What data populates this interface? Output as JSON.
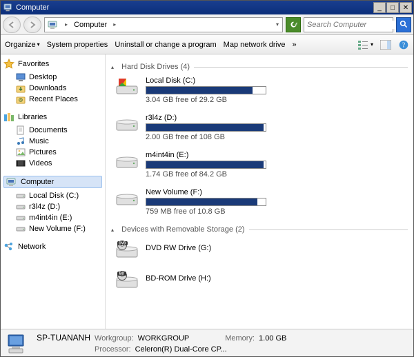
{
  "window": {
    "title": "Computer"
  },
  "address": {
    "location": "Computer"
  },
  "search": {
    "placeholder": "Search Computer"
  },
  "toolbar": {
    "organize": "Organize",
    "sysprops": "System properties",
    "uninstall": "Uninstall or change a program",
    "mapdrive": "Map network drive",
    "overflow": "»"
  },
  "sidebar": {
    "favorites": {
      "label": "Favorites",
      "items": [
        "Desktop",
        "Downloads",
        "Recent Places"
      ]
    },
    "libraries": {
      "label": "Libraries",
      "items": [
        "Documents",
        "Music",
        "Pictures",
        "Videos"
      ]
    },
    "computer": {
      "label": "Computer",
      "items": [
        "Local Disk (C:)",
        "r3l4z (D:)",
        "m4int4in (E:)",
        "New Volume (F:)"
      ]
    },
    "network": {
      "label": "Network"
    }
  },
  "sections": {
    "hdd": {
      "title": "Hard Disk Drives (4)"
    },
    "rem": {
      "title": "Devices with Removable Storage (2)"
    }
  },
  "drives": {
    "hdd": [
      {
        "name": "Local Disk (C:)",
        "free": "3.04 GB free of 29.2 GB",
        "pct": 89
      },
      {
        "name": "r3l4z (D:)",
        "free": "2.00 GB free of 108 GB",
        "pct": 98
      },
      {
        "name": "m4int4in (E:)",
        "free": "1.74 GB free of 84.2 GB",
        "pct": 98
      },
      {
        "name": "New Volume (F:)",
        "free": "759 MB free of 10.8 GB",
        "pct": 93
      }
    ],
    "rem": [
      {
        "name": "DVD RW Drive (G:)",
        "badge": "DVD"
      },
      {
        "name": "BD-ROM Drive (H:)",
        "badge": "BD"
      }
    ]
  },
  "status": {
    "host": "SP-TUANANH",
    "workgroup_lbl": "Workgroup:",
    "workgroup": "WORKGROUP",
    "memory_lbl": "Memory:",
    "memory": "1.00 GB",
    "processor_lbl": "Processor:",
    "processor": "Celeron(R) Dual-Core CP..."
  }
}
